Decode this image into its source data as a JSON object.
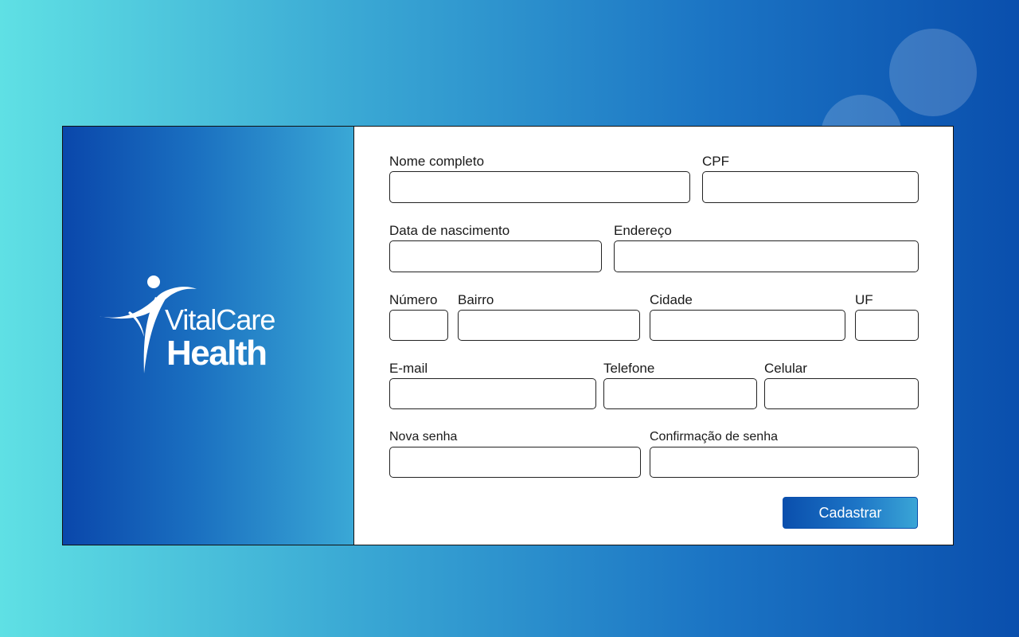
{
  "brand": {
    "line1": "VitalCare",
    "line2": "Health",
    "logo_icon": "person-swoosh-icon"
  },
  "form": {
    "fields": {
      "nome": {
        "label": "Nome completo",
        "value": ""
      },
      "cpf": {
        "label": "CPF",
        "value": ""
      },
      "nascimento": {
        "label": "Data de nascimento",
        "value": ""
      },
      "endereco": {
        "label": "Endereço",
        "value": ""
      },
      "numero": {
        "label": "Número",
        "value": ""
      },
      "bairro": {
        "label": "Bairro",
        "value": ""
      },
      "cidade": {
        "label": "Cidade",
        "value": ""
      },
      "uf": {
        "label": "UF",
        "value": ""
      },
      "email": {
        "label": "E-mail",
        "value": ""
      },
      "telefone": {
        "label": "Telefone",
        "value": ""
      },
      "celular": {
        "label": "Celular",
        "value": ""
      },
      "senha": {
        "label": "Nova senha",
        "value": ""
      },
      "confirmacao": {
        "label": "Confirmação de senha",
        "value": ""
      }
    },
    "submit_label": "Cadastrar"
  },
  "colors": {
    "brand_dark": "#0a47ab",
    "brand_light": "#3aa8d6",
    "background_start": "#5fe0e4",
    "background_end": "#0a4fad"
  }
}
